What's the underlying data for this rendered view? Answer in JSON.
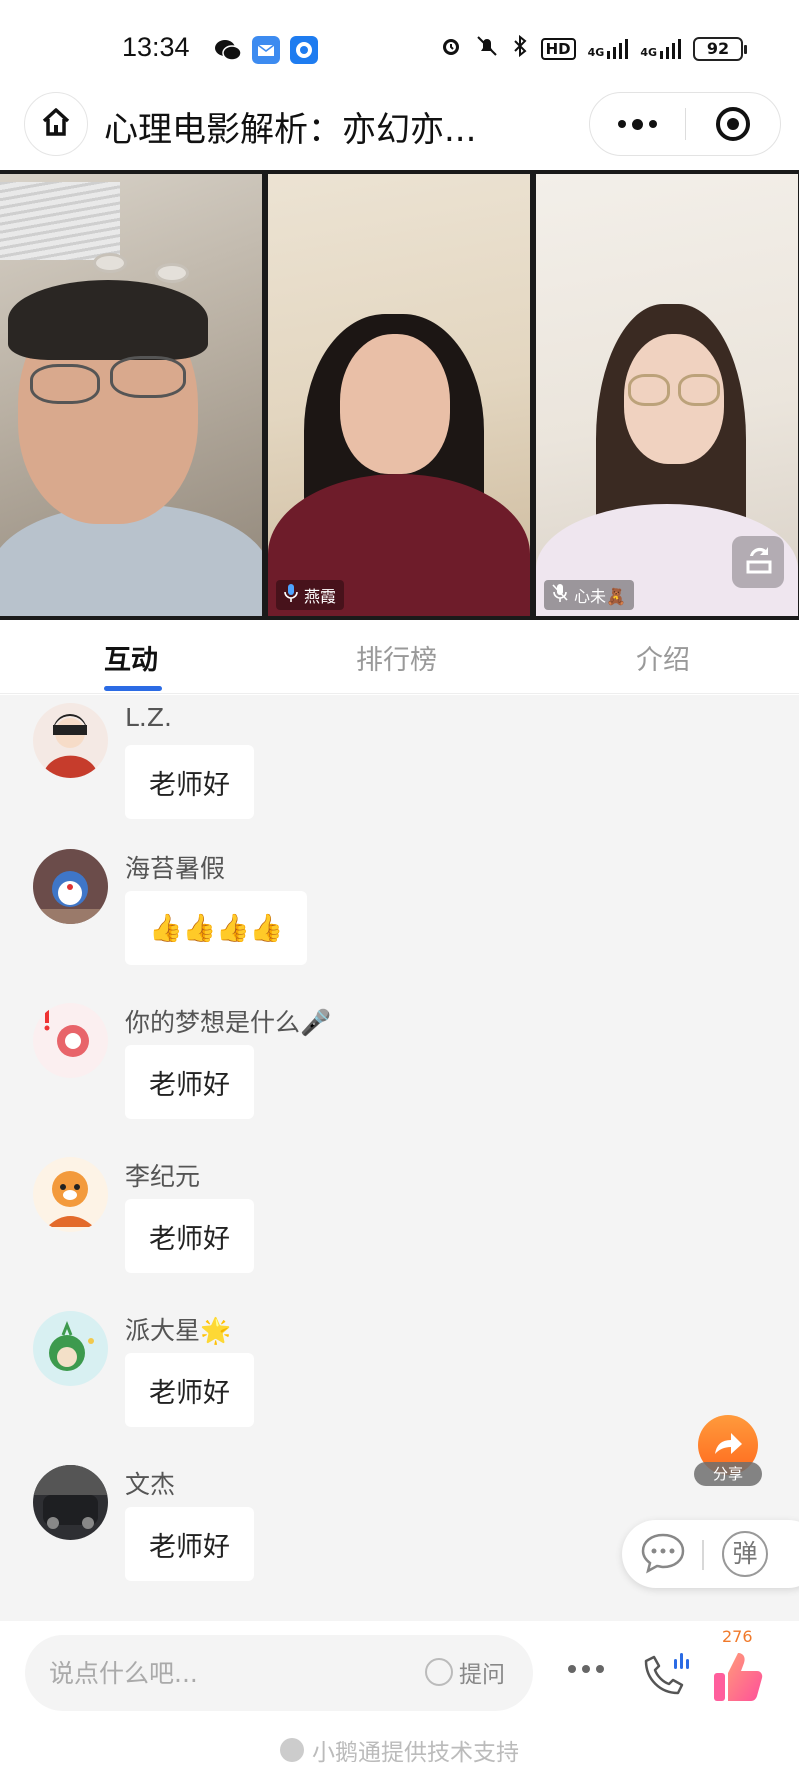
{
  "status_bar": {
    "time": "13:34",
    "icons": [
      "wechat-icon",
      "mail-icon",
      "qq-icon"
    ],
    "right_icons": [
      "alarm-icon",
      "mute-icon",
      "bluetooth-icon",
      "hd-icon",
      "signal-icon",
      "signal-icon"
    ],
    "hd": "HD",
    "net1": "4G",
    "net2": "4G",
    "battery": "92"
  },
  "nav": {
    "title": "心理电影解析：亦幻亦...",
    "home_icon": "home-icon",
    "more_icon": "more-dots-icon",
    "close_icon": "target-close-icon"
  },
  "video": {
    "participants": [
      {
        "label": ""
      },
      {
        "label": "燕霞",
        "mic": "mic-on-icon"
      },
      {
        "label": "心未🧸",
        "mic": "mic-muted-icon"
      }
    ],
    "rotate_icon": "rotate-screen-icon"
  },
  "tabs": [
    {
      "label": "互动",
      "active": true
    },
    {
      "label": "排行榜",
      "active": false
    },
    {
      "label": "介绍",
      "active": false
    }
  ],
  "messages": [
    {
      "name": "L.Z.",
      "text": "老师好"
    },
    {
      "name": "海苔暑假",
      "text": "👍👍👍👍"
    },
    {
      "name": "你的梦想是什么🎤",
      "text": "老师好"
    },
    {
      "name": "李纪元",
      "text": "老师好"
    },
    {
      "name": "派大星🌟",
      "text": "老师好"
    },
    {
      "name": "文杰",
      "text": "老师好"
    }
  ],
  "share": {
    "label": "分享"
  },
  "danmu": {
    "label": "弹"
  },
  "bottom": {
    "input_placeholder": "说点什么吧...",
    "ask_label": "提问",
    "like_count": "276",
    "powered_by": "小鹅通提供技术支持"
  },
  "colors": {
    "accent": "#2b6be4",
    "share_orange": "#ff7a2a",
    "like_pink": "#ff5e9c"
  }
}
